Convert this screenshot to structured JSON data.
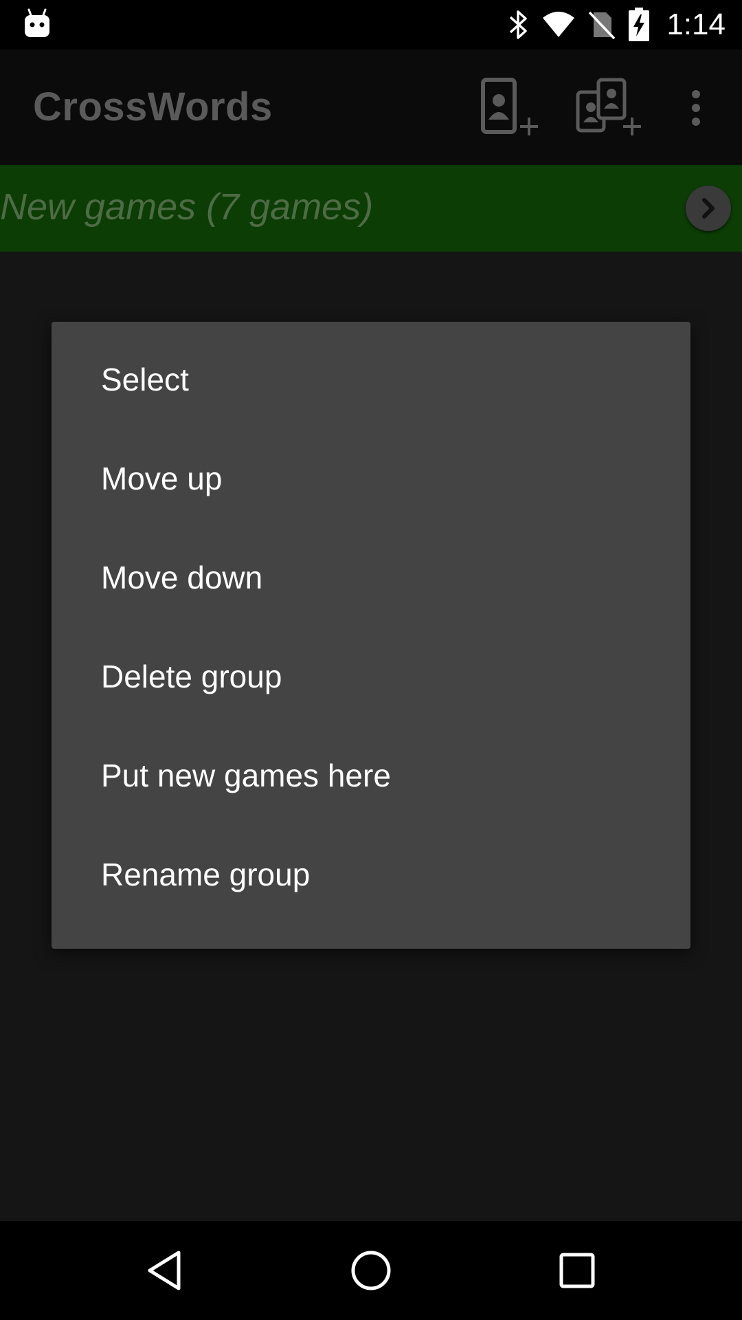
{
  "status_bar": {
    "time": "1:14",
    "icons": [
      "android-debug-icon",
      "bluetooth-icon",
      "wifi-icon",
      "no-sim-icon",
      "battery-charging-icon"
    ]
  },
  "app_bar": {
    "title": "CrossWords",
    "actions": [
      "add-local-game-icon",
      "add-network-game-icon",
      "overflow-menu-icon"
    ]
  },
  "group_header": {
    "title": "New games (7 games)",
    "expand_icon": "chevron-right-icon"
  },
  "context_menu": {
    "items": [
      {
        "label": "Select"
      },
      {
        "label": "Move up"
      },
      {
        "label": "Move down"
      },
      {
        "label": "Delete group"
      },
      {
        "label": "Put new games here"
      },
      {
        "label": "Rename group"
      }
    ]
  },
  "nav_bar": {
    "icons": [
      "back-icon",
      "home-icon",
      "recents-icon"
    ]
  },
  "colors": {
    "status_bar_bg": "#000000",
    "app_bar_bg": "#0b0b0b",
    "group_header_bg": "#0b3d05",
    "dialog_bg": "#444444",
    "menu_text": "#ffffff"
  }
}
